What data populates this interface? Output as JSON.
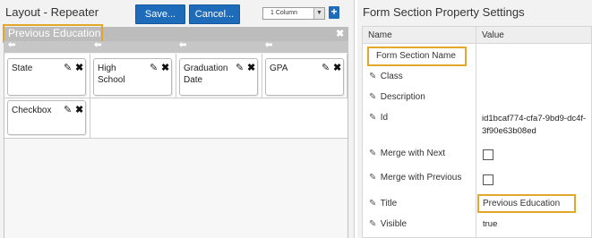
{
  "layout": {
    "title": "Layout - Repeater",
    "save_label": "Save...",
    "cancel_label": "Cancel...",
    "columns_value": "1 Column",
    "select_arrow": "▼",
    "add_label": "+",
    "section_title": "Previous Education",
    "close_glyph": "✖",
    "arrow_glyph": "⬅",
    "fields": [
      {
        "label": "State"
      },
      {
        "label": "High School"
      },
      {
        "label": "Graduation Date"
      },
      {
        "label": "GPA"
      },
      {
        "label": "Checkbox"
      }
    ],
    "edit_glyph": "✎",
    "delete_glyph": "✖"
  },
  "properties": {
    "title": "Form Section Property Settings",
    "header_name": "Name",
    "header_value": "Value",
    "highlighted_name": "Form Section Name",
    "edit_glyph": "✎",
    "rows": [
      {
        "name": "Class",
        "value": ""
      },
      {
        "name": "Description",
        "value": ""
      },
      {
        "name": "Id",
        "value": "id1bcaf774-cfa7-9bd9-dc4f-3f90e63b08ed"
      },
      {
        "name": "Merge with Next",
        "value": ""
      },
      {
        "name": "Merge with Previous",
        "value": ""
      },
      {
        "name": "Title",
        "value": "Previous Education"
      },
      {
        "name": "Visible",
        "value": "true"
      }
    ]
  },
  "colors": {
    "accent_blue": "#1d6bb9",
    "highlight_orange": "#e2a72b",
    "header_gray": "#bcbcbc"
  }
}
